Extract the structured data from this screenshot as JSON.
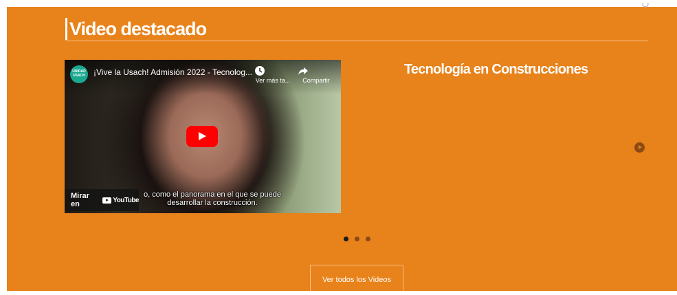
{
  "section": {
    "title": "Video destacado"
  },
  "video": {
    "channel_logo_text": "UNIDAD USACH",
    "title": "¡Vive la Usach! Admisión 2022 - Tecnolog...",
    "watch_later_label": "Ver más ta...",
    "share_label": "Compartir",
    "subtitle_line1": "o, como el panorama en el que se puede",
    "subtitle_line2": "desarrollar la construcción.",
    "watch_on_label": "Mirar en",
    "youtube_label": "YouTube"
  },
  "featured": {
    "heading": "Tecnología en Construcciones"
  },
  "carousel": {
    "active_index": 0,
    "count": 3
  },
  "footer": {
    "view_all_label": "Ver todos los Videos"
  },
  "colors": {
    "background": "#e8821a",
    "accent_dark": "#8a4a14",
    "youtube_red": "#ff0000"
  }
}
